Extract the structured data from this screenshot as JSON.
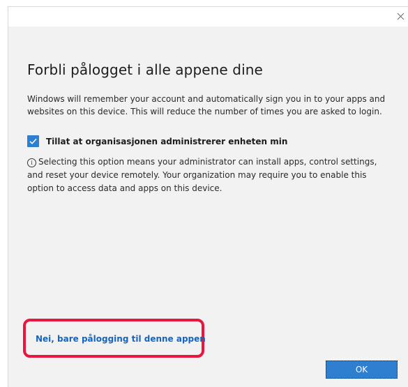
{
  "window": {
    "close_icon": "close-icon"
  },
  "dialog": {
    "title": "Forbli pålogget i alle appene dine",
    "description": "Windows will remember your account and automatically sign you in to your apps and websites on this device. This will reduce the number of times you are asked to login.",
    "checkbox": {
      "label": "Tillat at organisasjonen administrerer enheten min",
      "checked": true
    },
    "info_icon": "info-icon",
    "info_text": "Selecting this option means your administrator can install apps, control settings, and reset your device remotely. Your organization may require you to enable this option to access data and apps on this device.",
    "app_only_link": "Nei, bare pålogging til denne appen",
    "ok_button": "OK"
  },
  "colors": {
    "accent": "#2f7fd0",
    "link": "#1565c0",
    "highlight": "#e8173f",
    "dialog_background": "#f2f2f2"
  }
}
